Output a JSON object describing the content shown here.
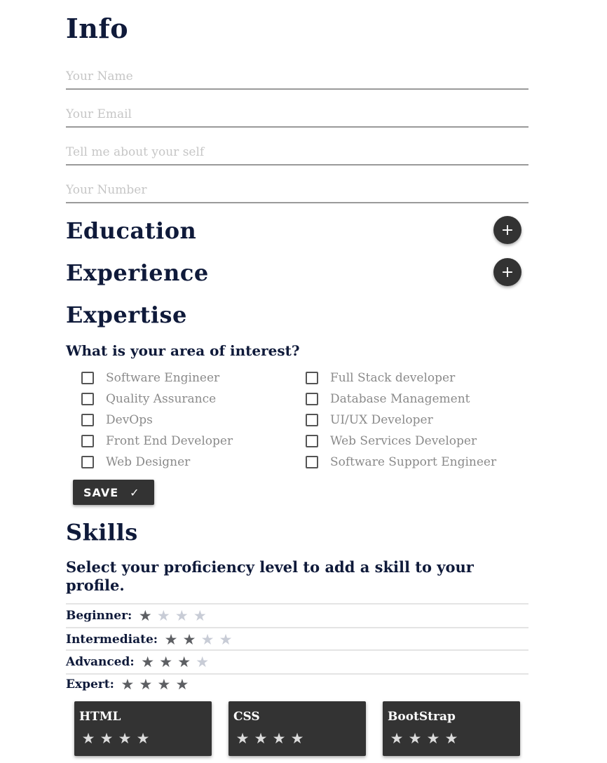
{
  "info": {
    "title": "Info",
    "fields": [
      {
        "placeholder": "Your Name",
        "value": ""
      },
      {
        "placeholder": "Your Email",
        "value": ""
      },
      {
        "placeholder": "Tell me about your self",
        "value": ""
      },
      {
        "placeholder": "Your Number",
        "value": ""
      }
    ]
  },
  "education": {
    "title": "Education",
    "add_label": "+"
  },
  "experience": {
    "title": "Experience",
    "add_label": "+"
  },
  "expertise": {
    "title": "Expertise",
    "question": "What is your area of interest?",
    "options": [
      {
        "label": "Software Engineer",
        "checked": false
      },
      {
        "label": "Full Stack developer",
        "checked": false
      },
      {
        "label": "Quality Assurance",
        "checked": false
      },
      {
        "label": "Database Management",
        "checked": false
      },
      {
        "label": "DevOps",
        "checked": false
      },
      {
        "label": "UI/UX Developer",
        "checked": false
      },
      {
        "label": "Front End Developer",
        "checked": false
      },
      {
        "label": "Web Services Developer",
        "checked": false
      },
      {
        "label": "Web Designer",
        "checked": false
      },
      {
        "label": "Software Support Engineer",
        "checked": false
      }
    ],
    "save_label": "SAVE",
    "save_icon": "✓"
  },
  "skills": {
    "title": "Skills",
    "prompt": "Select your proficiency level to add a skill to your profile.",
    "levels": [
      {
        "name": "Beginner:",
        "rating": 1,
        "max": 4
      },
      {
        "name": "Intermediate:",
        "rating": 2,
        "max": 4
      },
      {
        "name": "Advanced:",
        "rating": 3,
        "max": 4
      },
      {
        "name": "Expert:",
        "rating": 4,
        "max": 4
      }
    ],
    "cards": [
      {
        "name": "HTML",
        "rating": 4,
        "max": 4
      },
      {
        "name": "CSS",
        "rating": 4,
        "max": 4
      },
      {
        "name": "BootStrap",
        "rating": 4,
        "max": 4
      }
    ]
  },
  "icons": {
    "add": "plus-icon",
    "save": "check-icon",
    "star": "star-icon"
  },
  "colors": {
    "heading": "#0f1a3a",
    "button_bg": "#333333",
    "star_on": "#5d5f63",
    "star_off": "#c8ccd6"
  }
}
